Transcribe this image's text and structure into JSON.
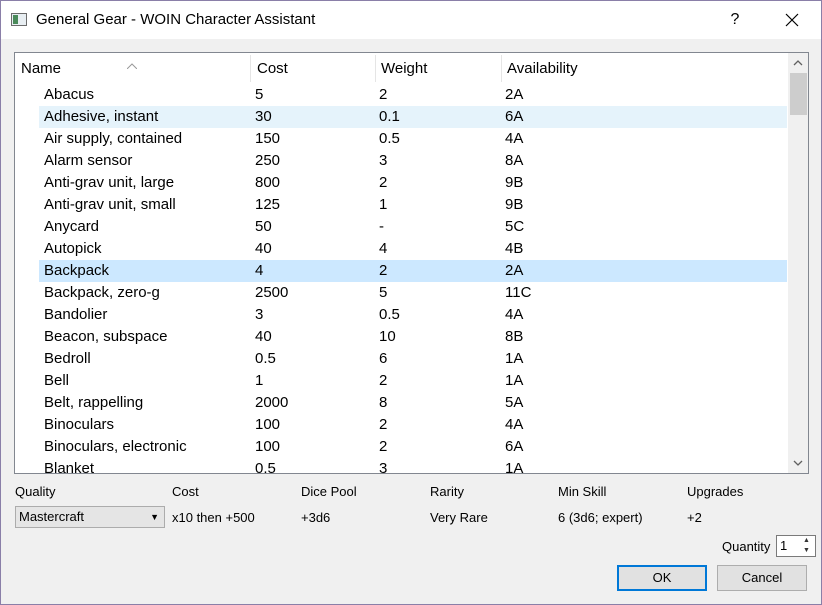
{
  "window": {
    "title": "General Gear - WOIN Character Assistant",
    "help_label": "?",
    "close_label": "✕"
  },
  "table": {
    "columns": [
      "Name",
      "Cost",
      "Weight",
      "Availability"
    ],
    "sort_indicator": "^",
    "selected_row": "Backpack",
    "hovered_row": "Adhesive, instant",
    "rows": [
      {
        "name": "Abacus",
        "cost": "5",
        "weight": "2",
        "availability": "2A"
      },
      {
        "name": "Adhesive, instant",
        "cost": "30",
        "weight": "0.1",
        "availability": "6A"
      },
      {
        "name": "Air supply, contained",
        "cost": "150",
        "weight": "0.5",
        "availability": "4A"
      },
      {
        "name": "Alarm sensor",
        "cost": "250",
        "weight": "3",
        "availability": "8A"
      },
      {
        "name": "Anti-grav unit, large",
        "cost": "800",
        "weight": "2",
        "availability": "9B"
      },
      {
        "name": "Anti-grav unit, small",
        "cost": "125",
        "weight": "1",
        "availability": "9B"
      },
      {
        "name": "Anycard",
        "cost": "50",
        "weight": "-",
        "availability": "5C"
      },
      {
        "name": "Autopick",
        "cost": "40",
        "weight": "4",
        "availability": "4B"
      },
      {
        "name": "Backpack",
        "cost": "4",
        "weight": "2",
        "availability": "2A"
      },
      {
        "name": "Backpack, zero-g",
        "cost": "2500",
        "weight": "5",
        "availability": "11C"
      },
      {
        "name": "Bandolier",
        "cost": "3",
        "weight": "0.5",
        "availability": "4A"
      },
      {
        "name": "Beacon, subspace",
        "cost": "40",
        "weight": "10",
        "availability": "8B"
      },
      {
        "name": "Bedroll",
        "cost": "0.5",
        "weight": "6",
        "availability": "1A"
      },
      {
        "name": "Bell",
        "cost": "1",
        "weight": "2",
        "availability": "1A"
      },
      {
        "name": "Belt, rappelling",
        "cost": "2000",
        "weight": "8",
        "availability": "5A"
      },
      {
        "name": "Binoculars",
        "cost": "100",
        "weight": "2",
        "availability": "4A"
      },
      {
        "name": "Binoculars, electronic",
        "cost": "100",
        "weight": "2",
        "availability": "6A"
      },
      {
        "name": "Blanket",
        "cost": "0.5",
        "weight": "3",
        "availability": "1A"
      }
    ]
  },
  "properties": {
    "quality_label": "Quality",
    "quality_value": "Mastercraft",
    "cost_label": "Cost",
    "cost_value": "x10 then +500",
    "dice_pool_label": "Dice Pool",
    "dice_pool_value": "+3d6",
    "rarity_label": "Rarity",
    "rarity_value": "Very Rare",
    "min_skill_label": "Min Skill",
    "min_skill_value": "6 (3d6; expert)",
    "upgrades_label": "Upgrades",
    "upgrades_value": "+2"
  },
  "quantity": {
    "label": "Quantity",
    "value": "1"
  },
  "buttons": {
    "ok": "OK",
    "cancel": "Cancel"
  },
  "colors": {
    "selected_row": "#cce8ff",
    "hover_row": "#e5f3fb",
    "ok_border": "#0078d7"
  }
}
